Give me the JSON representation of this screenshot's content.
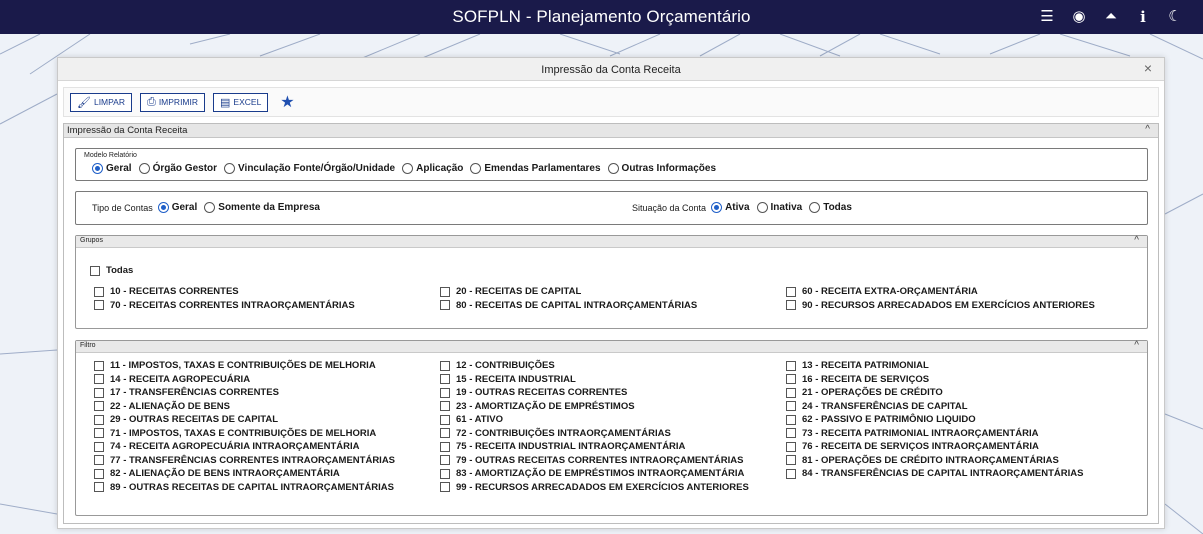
{
  "app": {
    "title": "SOFPLN - Planejamento Orçamentário",
    "icons": [
      "list-icon",
      "eye-icon",
      "user-icon",
      "info-icon",
      "moon-icon"
    ]
  },
  "dialog": {
    "title": "Impressão da Conta Receita",
    "close": "×"
  },
  "toolbar": {
    "limpar": "LIMPAR",
    "imprimir": "IMPRIMIR",
    "excel": "EXCEL"
  },
  "main_panel": {
    "title": "Impressão da Conta Receita",
    "caret": "^"
  },
  "modelo": {
    "legend": "Modelo Relatório",
    "options": [
      "Geral",
      "Órgão Gestor",
      "Vinculação Fonte/Órgão/Unidade",
      "Aplicação",
      "Emendas Parlamentares",
      "Outras Informações"
    ],
    "selected": "Geral"
  },
  "tipo_contas": {
    "label": "Tipo de Contas",
    "options": [
      "Geral",
      "Somente da Empresa"
    ],
    "selected": "Geral"
  },
  "situacao": {
    "label": "Situação da Conta",
    "options": [
      "Ativa",
      "Inativa",
      "Todas"
    ],
    "selected": "Ativa"
  },
  "grupos": {
    "title": "Grupos",
    "caret": "^",
    "todas": "Todas",
    "col1": [
      "10 - RECEITAS CORRENTES",
      "70 - RECEITAS CORRENTES INTRAORÇAMENTÁRIAS"
    ],
    "col2": [
      "20 - RECEITAS DE CAPITAL",
      "80 - RECEITAS DE CAPITAL INTRAORÇAMENTÁRIAS"
    ],
    "col3": [
      "60 - RECEITA EXTRA-ORÇAMENTÁRIA",
      "90 - RECURSOS ARRECADADOS EM EXERCÍCIOS ANTERIORES"
    ]
  },
  "filtro": {
    "title": "Filtro",
    "caret": "^",
    "col1": [
      "11 - IMPOSTOS, TAXAS E CONTRIBUIÇÕES DE MELHORIA",
      "14 - RECEITA AGROPECUÁRIA",
      "17 - TRANSFERÊNCIAS CORRENTES",
      "22 - ALIENAÇÃO DE BENS",
      "29 - OUTRAS RECEITAS DE CAPITAL",
      "71 - IMPOSTOS, TAXAS E CONTRIBUIÇÕES DE MELHORIA",
      "74 - RECEITA AGROPECUÁRIA INTRAORÇAMENTÁRIA",
      "77 - TRANSFERÊNCIAS CORRENTES INTRAORÇAMENTÁRIAS",
      "82 - ALIENAÇÃO DE BENS INTRAORÇAMENTÁRIA",
      "89 - OUTRAS RECEITAS DE CAPITAL INTRAORÇAMENTÁRIAS"
    ],
    "col2": [
      "12 - CONTRIBUIÇÕES",
      "15 - RECEITA INDUSTRIAL",
      "19 - OUTRAS RECEITAS CORRENTES",
      "23 - AMORTIZAÇÃO DE EMPRÉSTIMOS",
      "61 - ATIVO",
      "72 - CONTRIBUIÇÕES INTRAORÇAMENTÁRIAS",
      "75 - RECEITA INDUSTRIAL INTRAORÇAMENTÁRIA",
      "79 - OUTRAS RECEITAS CORRENTES INTRAORÇAMENTÁRIAS",
      "83 - AMORTIZAÇÃO DE EMPRÉSTIMOS INTRAORÇAMENTÁRIA",
      "99 - RECURSOS ARRECADADOS EM EXERCÍCIOS ANTERIORES"
    ],
    "col3": [
      "13 - RECEITA PATRIMONIAL",
      "16 - RECEITA DE SERVIÇOS",
      "21 - OPERAÇÕES DE CRÉDITO",
      "24 - TRANSFERÊNCIAS DE CAPITAL",
      "62 - PASSIVO E PATRIMÔNIO LIQUIDO",
      "73 - RECEITA PATRIMONIAL INTRAORÇAMENTÁRIA",
      "76 - RECEITA DE SERVIÇOS INTRAORÇAMENTÁRIA",
      "81 - OPERAÇÕES DE CRÉDITO INTRAORÇAMENTÁRIAS",
      "84 - TRANSFERÊNCIAS DE CAPITAL INTRAORÇAMENTÁRIAS"
    ]
  }
}
